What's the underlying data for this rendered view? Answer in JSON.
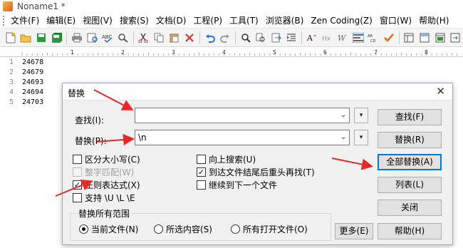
{
  "window": {
    "title": "Noname1 *"
  },
  "menu": [
    "文件(F)",
    "编辑(E)",
    "视图(V)",
    "搜索(S)",
    "文档(D)",
    "工程(P)",
    "工具(T)",
    "浏览器(B)",
    "Zen Coding(Z)",
    "窗口(W)",
    "帮助(H)"
  ],
  "ruler": {
    "marks": [
      "1",
      "2",
      "3",
      "4",
      "5",
      "6",
      "7",
      "8"
    ]
  },
  "editor": {
    "lines": [
      {
        "n": "1",
        "text": "24678"
      },
      {
        "n": "2",
        "text": "24679"
      },
      {
        "n": "3",
        "text": "24693"
      },
      {
        "n": "4",
        "text": "24694"
      },
      {
        "n": "5",
        "text": "24703"
      }
    ]
  },
  "dialog": {
    "title": "替换",
    "find_label": "查找(I):",
    "find_value": "",
    "replace_label": "替换(P):",
    "replace_value": "\\n",
    "options": {
      "case": "区分大小写(C)",
      "whole_word": "整字匹配(W)",
      "regex": "正则表达式(X)",
      "ule": "支持 \\U \\L \\E",
      "search_up": "向上搜索(U)",
      "wrap": "到达文件结尾后重头再找(T)",
      "next": "继续到下一个文件"
    },
    "scope": {
      "title": "替换所有范围",
      "current": "当前文件(N)",
      "selection": "所选内容(S)",
      "all_open": "所有打开文件(O)"
    },
    "buttons": {
      "find": "查找(F)",
      "replace": "替换(R)",
      "replace_all": "全部替换(A)",
      "list": "列表(L)",
      "close": "关闭",
      "more": "更多(E)",
      "help": "帮助(H)"
    },
    "dots": "▾"
  },
  "colors": {
    "accent": "#0078d7",
    "annotation_arrow": "#e8272b"
  }
}
